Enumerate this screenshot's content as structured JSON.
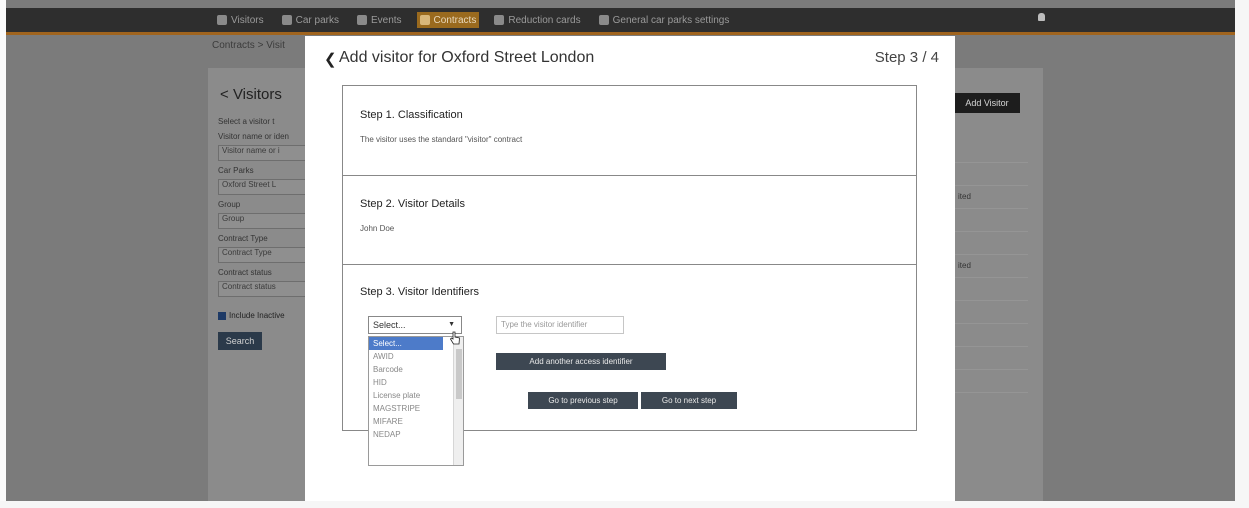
{
  "nav": {
    "items": [
      {
        "label": "Visitors",
        "icon": "people-icon",
        "active": false
      },
      {
        "label": "Car parks",
        "icon": "parking-icon",
        "active": false
      },
      {
        "label": "Events",
        "icon": "bell-icon",
        "active": false
      },
      {
        "label": "Contracts",
        "icon": "document-icon",
        "active": true
      },
      {
        "label": "Reduction cards",
        "icon": "card-icon",
        "active": false
      },
      {
        "label": "General car parks settings",
        "icon": "settings-icon",
        "active": false
      }
    ]
  },
  "background": {
    "breadcrumb": "Contracts > Visit",
    "title": "Visitors",
    "subtitle": "Select a visitor t",
    "fields": [
      {
        "label": "Visitor name or iden",
        "value": "Visitor name or i"
      },
      {
        "label": "Car Parks",
        "value": "Oxford Street L"
      },
      {
        "label": "Group",
        "value": "Group"
      },
      {
        "label": "Contract Type",
        "value": "Contract Type"
      },
      {
        "label": "Contract status",
        "value": "Contract status"
      }
    ],
    "include_inactive": "Include Inactive",
    "search_label": "Search",
    "add_visitor_label": "Add Visitor",
    "right_rows": [
      "",
      "",
      "ited",
      "",
      "",
      "ited",
      "",
      "",
      "",
      "",
      ""
    ]
  },
  "modal": {
    "title": "Add visitor for Oxford Street London",
    "step_indicator": "Step 3 / 4",
    "step1": {
      "title": "Step 1. Classification",
      "text": "The visitor uses the standard \"visitor\" contract"
    },
    "step2": {
      "title": "Step 2. Visitor Details",
      "text": "John Doe"
    },
    "step3": {
      "title": "Step 3. Visitor Identifiers",
      "select_value": "Select...",
      "options": [
        "Select...",
        "AWID",
        "Barcode",
        "HID",
        "License plate",
        "MAGSTRIPE",
        "MIFARE",
        "NEDAP"
      ],
      "identifier_placeholder": "Type the visitor identifier",
      "add_identifier_label": "Add another access identifier",
      "prev_label": "Go to previous step",
      "next_label": "Go to next step"
    }
  }
}
